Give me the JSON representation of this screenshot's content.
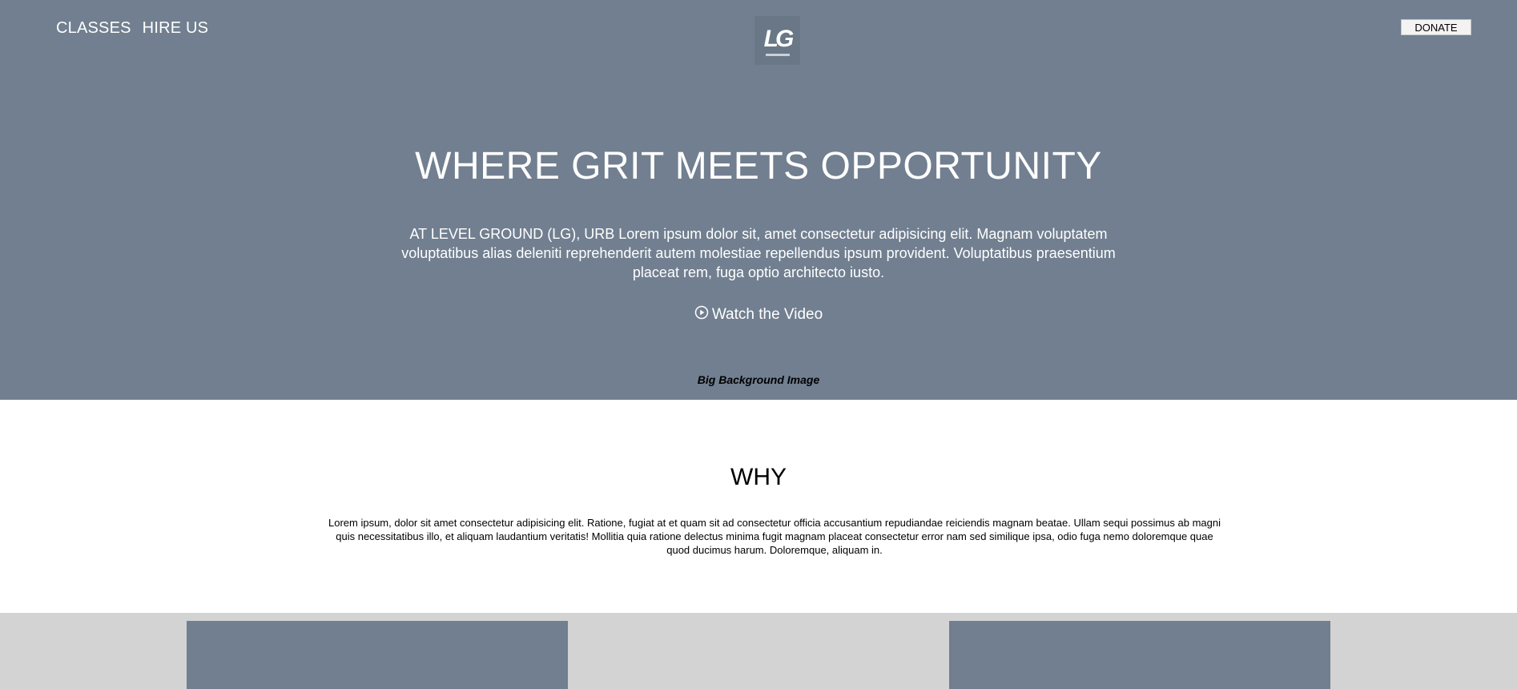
{
  "nav": {
    "items": [
      {
        "label": "CLASSES"
      },
      {
        "label": "HIRE US"
      }
    ],
    "donate_label": "DONATE"
  },
  "logo": {
    "mark": "LG"
  },
  "hero": {
    "title": "WHERE GRIT MEETS OPPORTUNITY",
    "text": "AT LEVEL GROUND (LG), URB Lorem ipsum dolor sit, amet consectetur adipisicing elit. Magnam voluptatem voluptatibus alias deleniti reprehenderit autem molestiae repellendus ipsum provident. Voluptatibus praesentium placeat rem, fuga optio architecto iusto.",
    "watch_label": "Watch the Video",
    "watch_icon": "play-circle-icon",
    "caption": "Big Background Image"
  },
  "why": {
    "title": "WHY",
    "text": "Lorem ipsum, dolor sit amet consectetur adipisicing elit. Ratione, fugiat at et quam sit ad consectetur officia accusantium repudiandae reiciendis magnam beatae. Ullam sequi possimus ab magni quis necessitatibus illo, et aliquam laudantium veritatis! Mollitia quia ratione delectus minima fugit magnam placeat consectetur error nam sed similique ipsa, odio fuga nemo doloremque quae quod ducimus harum. Doloremque, aliquam in."
  },
  "colors": {
    "hero_bg": "#717f90",
    "cards_bg": "#d3d3d4",
    "card_fill": "#717f90"
  }
}
